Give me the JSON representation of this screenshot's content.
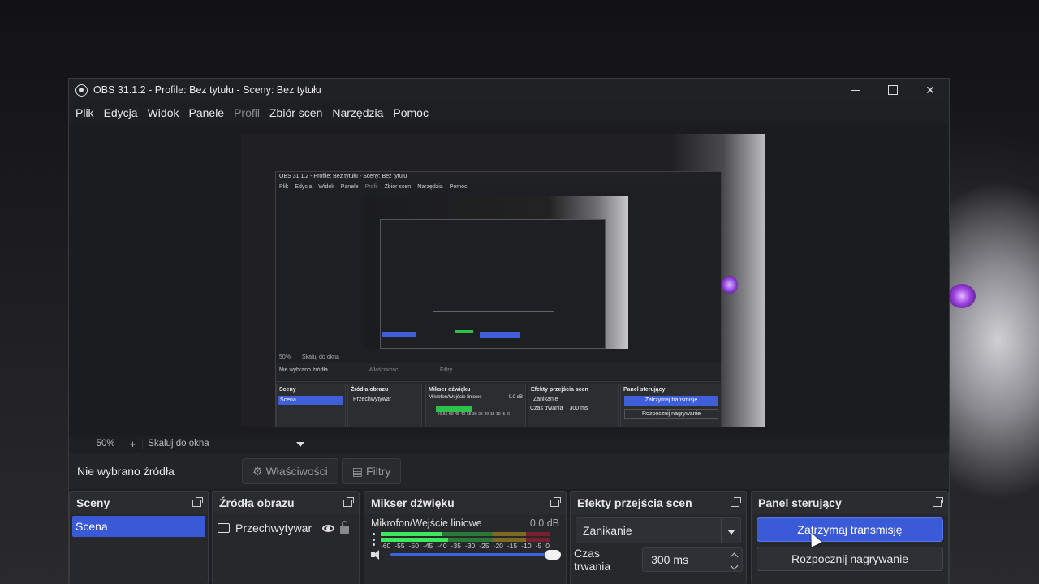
{
  "window": {
    "title": "OBS 31.1.2 - Profile: Bez tytułu - Sceny: Bez tytułu"
  },
  "menu": [
    "Plik",
    "Edycja",
    "Widok",
    "Panele",
    "Profil",
    "Zbiór scen",
    "Narzędzia",
    "Pomoc"
  ],
  "preview_toolbar": {
    "minus": "−",
    "zoom": "50%",
    "plus": "+",
    "scale_mode": "Skaluj do okna"
  },
  "source_bar": {
    "no_source": "Nie wybrano źródła",
    "properties": "Właściwości",
    "filters": "Filtry"
  },
  "docks": {
    "scenes": {
      "title": "Sceny",
      "items": [
        "Scena"
      ]
    },
    "sources": {
      "title": "Źródła obrazu",
      "items": [
        "Przechwytywar"
      ]
    },
    "mixer": {
      "title": "Mikser dźwięku",
      "channel": "Mikrofon/Wejście liniowe",
      "db": "0.0 dB",
      "ticks": [
        "-60",
        "-55",
        "-50",
        "-45",
        "-40",
        "-35",
        "-30",
        "-25",
        "-20",
        "-15",
        "-10",
        "-5",
        "0"
      ],
      "volume_level": 1.0
    },
    "transitions": {
      "title": "Efekty przejścia scen",
      "selected": "Zanikanie",
      "duration_label": "Czas trwania",
      "duration_value": "300 ms"
    },
    "controls": {
      "title": "Panel sterujący",
      "stop_stream": "Zatrzymaj transmisję",
      "start_record": "Rozpocznij nagrywanie"
    }
  },
  "nested_preview": {
    "title": "OBS 31.1.2 - Profile: Bez tytułu - Sceny: Bez tytułu",
    "menu": [
      "Plik",
      "Edycja",
      "Widok",
      "Panele",
      "Profil",
      "Zbiór scen",
      "Narzędzia",
      "Pomoc"
    ],
    "zoom": "50%",
    "scale_mode": "Skaluj do okna",
    "no_source": "Nie wybrano źródła",
    "properties": "Właściwości",
    "filters": "Filtry",
    "scenes": "Sceny",
    "scene_item": "Scena",
    "sources": "Źródła obrazu",
    "source_item": "Przechwytywar",
    "mixer": "Mikser dźwięku",
    "channel": "Mikrofon/Wejście liniowe",
    "db": "0.0 dB",
    "ticks": "-60-55-50-45-40-35-30-25-20-15-10 -5  0",
    "transitions": "Efekty przejścia scen",
    "transition_selected": "Zanikanie",
    "duration_label": "Czas trwania",
    "duration_value": "300 ms",
    "controls": "Panel sterujący",
    "stop_stream": "Zatrzymaj transmisję",
    "start_record": "Rozpocznij nagrywanie"
  }
}
